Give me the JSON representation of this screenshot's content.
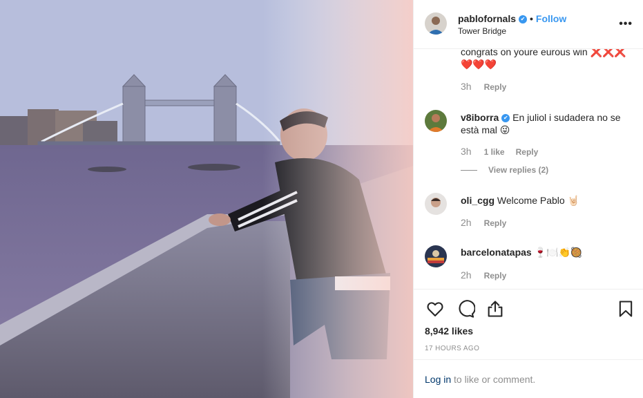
{
  "post": {
    "username": "pablofornals",
    "verified_mark": "✔",
    "separator": "•",
    "follow_label": "Follow",
    "location": "Tower Bridge",
    "more_label": "•••"
  },
  "comments": [
    {
      "text": "congrats on youre eurous win ❌❌❌",
      "text2": "❤️❤️❤️",
      "time": "3h",
      "reply_label": "Reply"
    },
    {
      "username": "v8iborra",
      "verified_mark": "✔",
      "text": "En juliol i sudadera no se",
      "text2": "està mal 😜",
      "time": "3h",
      "likes_label": "1 like",
      "reply_label": "Reply",
      "view_replies": "View replies (2)"
    },
    {
      "username": "oli_cgg",
      "text": "Welcome Pablo 🤘🏻",
      "time": "2h",
      "reply_label": "Reply"
    },
    {
      "username": "barcelonatapas",
      "text": "🍷🍽️👏🥘",
      "time": "2h",
      "reply_label": "Reply"
    }
  ],
  "actions": {
    "likes": "8,942 likes",
    "posted_ago": "17 HOURS AGO"
  },
  "login": {
    "link_label": "Log in",
    "rest": " to like or comment."
  },
  "icons": {
    "like": "heart-icon",
    "comment": "comment-bubble-icon",
    "share": "share-icon",
    "save": "bookmark-icon"
  },
  "colors": {
    "accent": "#3897f0",
    "text": "#262626",
    "muted": "#8e8e8e",
    "link": "#00376b"
  }
}
